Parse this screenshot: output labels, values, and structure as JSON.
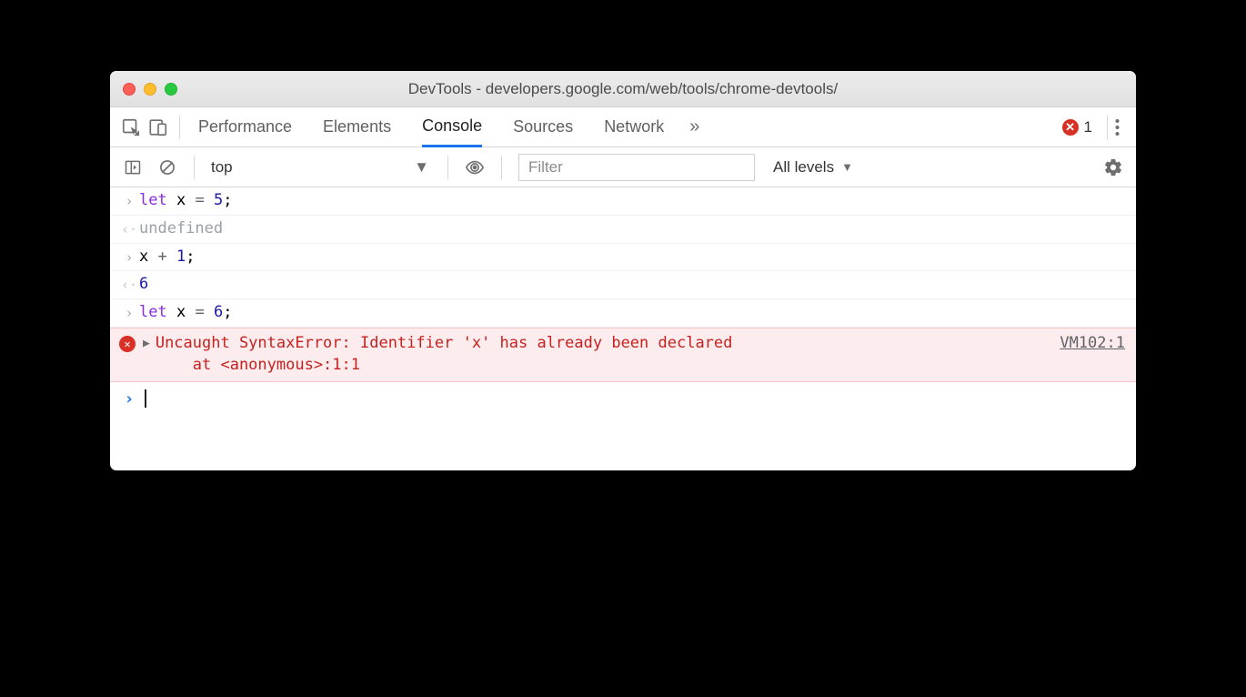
{
  "window": {
    "title": "DevTools - developers.google.com/web/tools/chrome-devtools/"
  },
  "tabs": {
    "items": [
      "Performance",
      "Elements",
      "Console",
      "Sources",
      "Network"
    ],
    "active": "Console",
    "overflow_glyph": "»",
    "error_count": "1"
  },
  "toolbar": {
    "context": "top",
    "filter_placeholder": "Filter",
    "levels_label": "All levels"
  },
  "console": {
    "entries": [
      {
        "type": "input",
        "code_html": "<span class='tok-kw'>let</span> x <span class='tok-op'>=</span> <span class='tok-num'>5</span>;"
      },
      {
        "type": "result",
        "text": "undefined",
        "class": "undef"
      },
      {
        "type": "input",
        "code_html": "x <span class='tok-op'>+</span> <span class='tok-num'>1</span>;"
      },
      {
        "type": "result",
        "text": "6",
        "class": "tok-num"
      },
      {
        "type": "input",
        "code_html": "<span class='tok-kw'>let</span> x <span class='tok-op'>=</span> <span class='tok-num'>6</span>;"
      }
    ],
    "error": {
      "message": "Uncaught SyntaxError: Identifier 'x' has already been declared\n    at <anonymous>:1:1",
      "source": "VM102:1"
    }
  }
}
